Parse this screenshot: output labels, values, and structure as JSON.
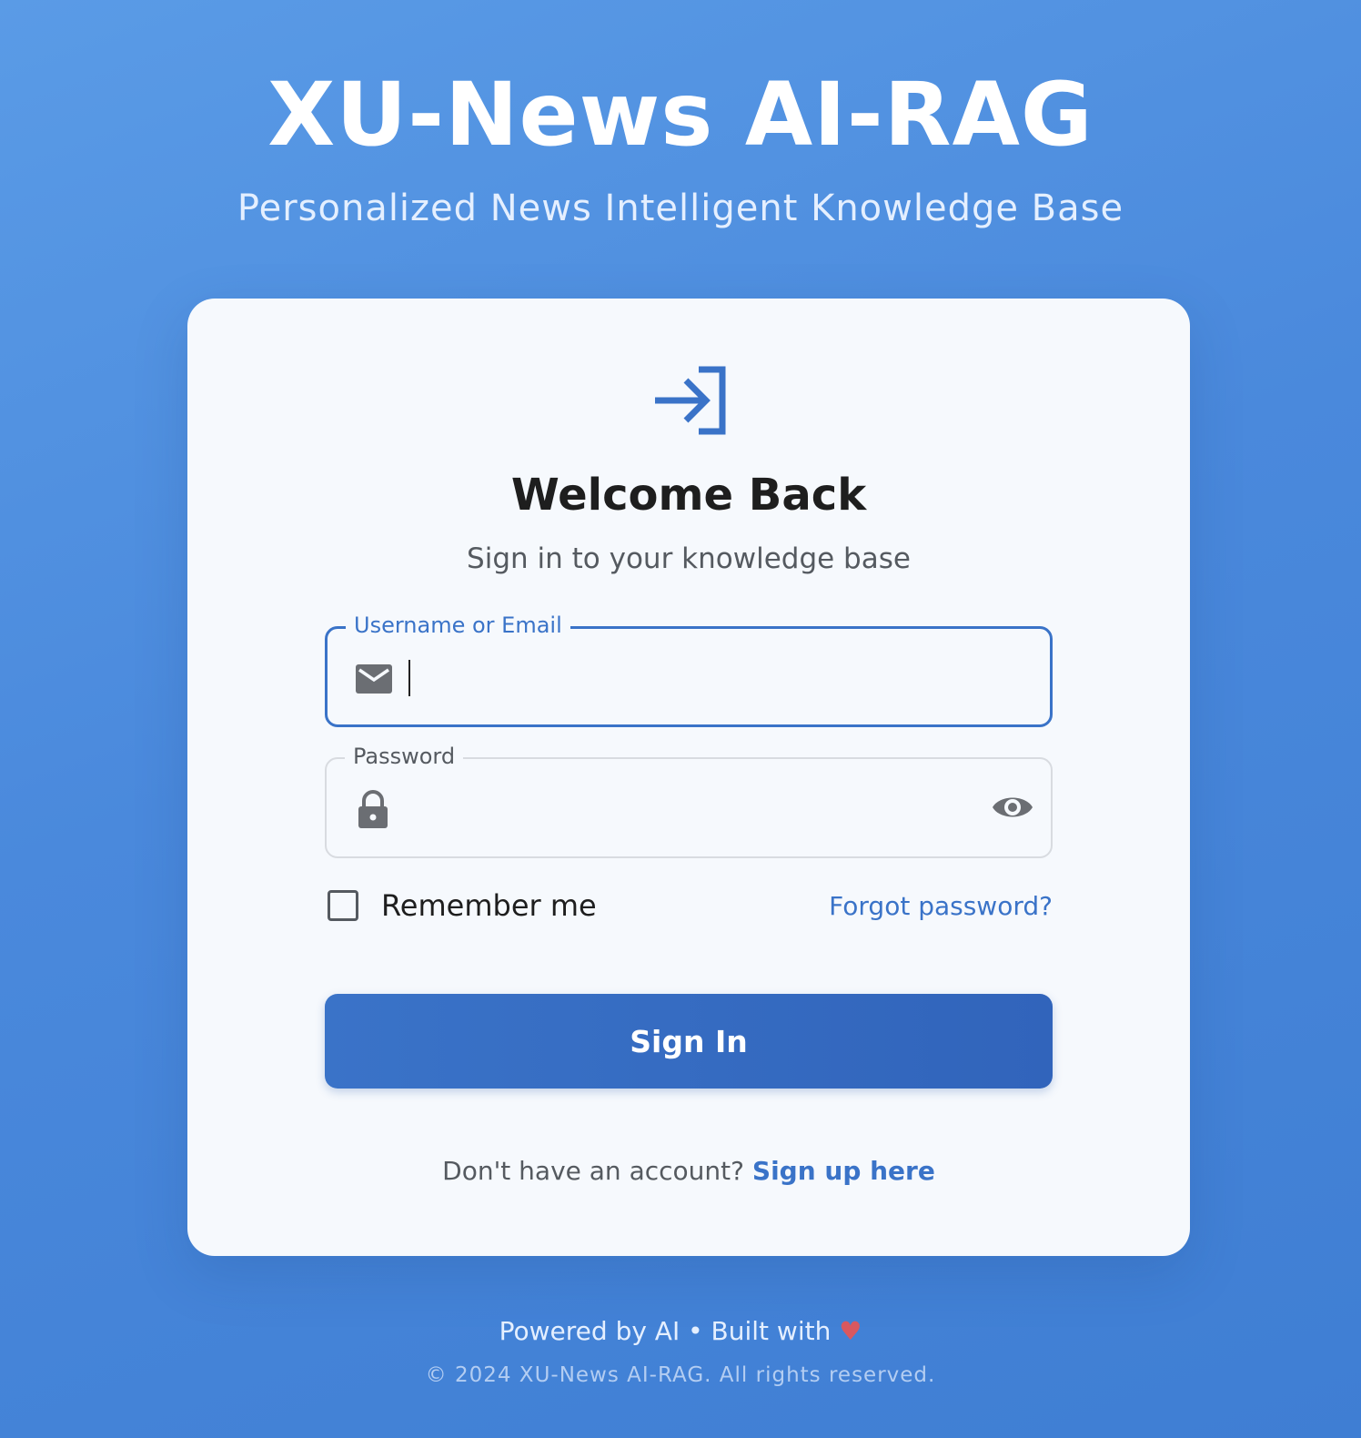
{
  "header": {
    "title": "XU-News AI-RAG",
    "subtitle": "Personalized News Intelligent Knowledge Base"
  },
  "card": {
    "icon": "login-arrow-icon",
    "title": "Welcome Back",
    "subtitle": "Sign in to your knowledge base",
    "username_field": {
      "label": "Username or Email",
      "value": "",
      "placeholder": "",
      "icon": "mail-icon"
    },
    "password_field": {
      "label": "Password",
      "value": "",
      "placeholder": "",
      "icon": "lock-icon",
      "toggle_icon": "eye-icon"
    },
    "remember_label": "Remember me",
    "remember_checked": false,
    "forgot_label": "Forgot password?",
    "signin_label": "Sign In",
    "signup_prompt": "Don't have an account?",
    "signup_link": "Sign up here"
  },
  "footer": {
    "powered": "Powered by AI • Built with",
    "heart": "♥",
    "copyright": "© 2024 XU-News AI-RAG. All rights reserved."
  },
  "colors": {
    "accent": "#3a73c8",
    "background": "#4a89dc",
    "card": "#f6f9fd"
  }
}
